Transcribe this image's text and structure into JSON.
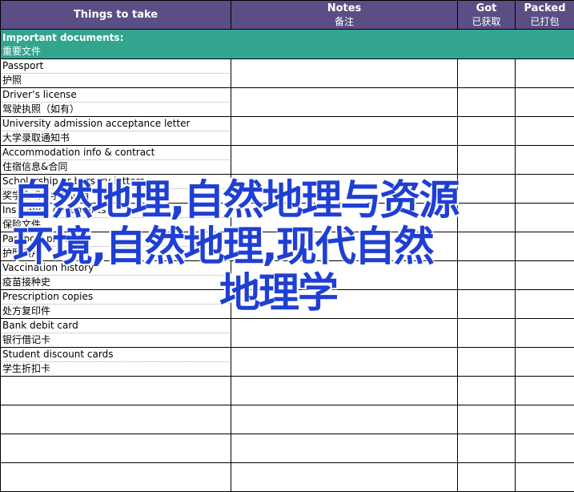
{
  "header": {
    "things": "Things to take",
    "notes_en": "Notes",
    "notes_zh": "备注",
    "got_en": "Got",
    "got_zh": "已获取",
    "packed_en": "Packed",
    "packed_zh": "已打包"
  },
  "section": {
    "title_en": "Important documents:",
    "title_zh": "重要文件"
  },
  "items": [
    {
      "en": "Passport",
      "zh": "护照"
    },
    {
      "en": "Driver’s license",
      "zh": "驾驶执照（如有）"
    },
    {
      "en": "University admission acceptance letter",
      "zh": "大学录取通知书"
    },
    {
      "en": "Accommodation info & contract",
      "zh": "住宿信息&合同"
    },
    {
      "en": "Scholarship or bursary letters",
      "zh": "奖学金或助学金证明"
    },
    {
      "en": "Insurance documents",
      "zh": "保险文件"
    },
    {
      "en": "Passport photos",
      "zh": "护照照片"
    },
    {
      "en": "Vaccination history",
      "zh": "疫苗接种史"
    },
    {
      "en": "Prescription copies",
      "zh": "处方复印件"
    },
    {
      "en": "Bank debit card",
      "zh": "银行借记卡"
    },
    {
      "en": "Student discount cards",
      "zh": "学生折扣卡"
    }
  ],
  "overlay": {
    "line1": "自然地理,自然地理与资源",
    "line2": "环境,自然地理,现代自然",
    "line3": "地理学"
  },
  "colors": {
    "header_bg": "#5b4e84",
    "section_bg": "#33a58f",
    "overlay_text": "#1f3fd4"
  }
}
